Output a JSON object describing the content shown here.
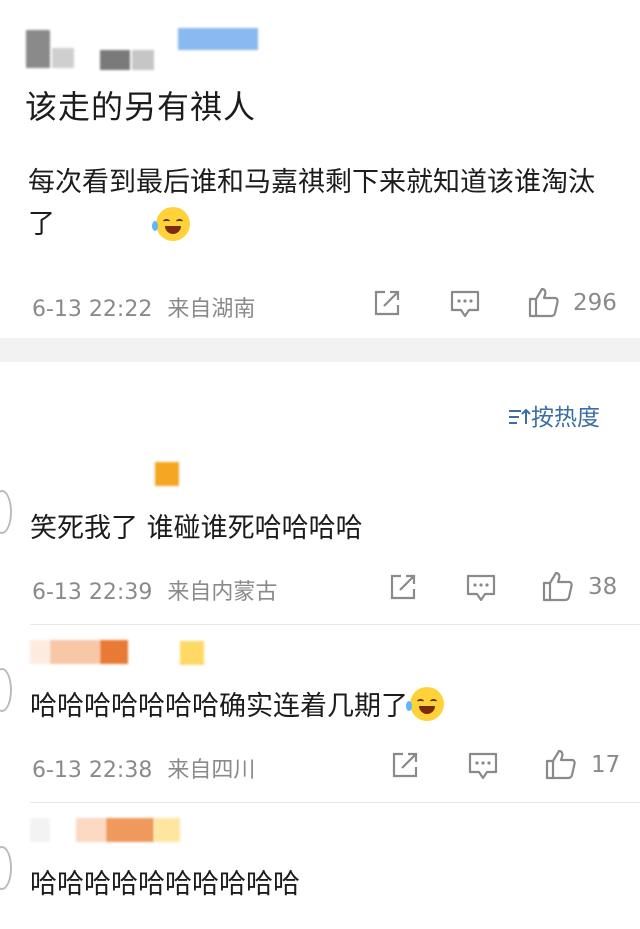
{
  "main_comment": {
    "title": "该走的另有祺人",
    "text": "每次看到最后谁和马嘉祺剩下来就知道该谁淘汰了",
    "emoji": "laughing-tears",
    "time": "6-13 22:22",
    "location": "来自湖南",
    "likes": "296"
  },
  "sort": {
    "label": "按热度",
    "icon": "sort-icon"
  },
  "replies": [
    {
      "text": "笑死我了 谁碰谁死哈哈哈哈",
      "time": "6-13 22:39",
      "location": "来自内蒙古",
      "likes": "38"
    },
    {
      "text": "哈哈哈哈哈哈哈确实连着几期了",
      "emoji": "laughing-tears",
      "time": "6-13 22:38",
      "location": "来自四川",
      "likes": "17"
    },
    {
      "text": "哈哈哈哈哈哈哈哈哈哈"
    }
  ],
  "colors": {
    "accent": "#3a6ea5",
    "divider": "#f2f2f2",
    "meta": "#8a8a8a",
    "badge_orange": "#f5a623",
    "badge_yellow": "#ffd966"
  }
}
